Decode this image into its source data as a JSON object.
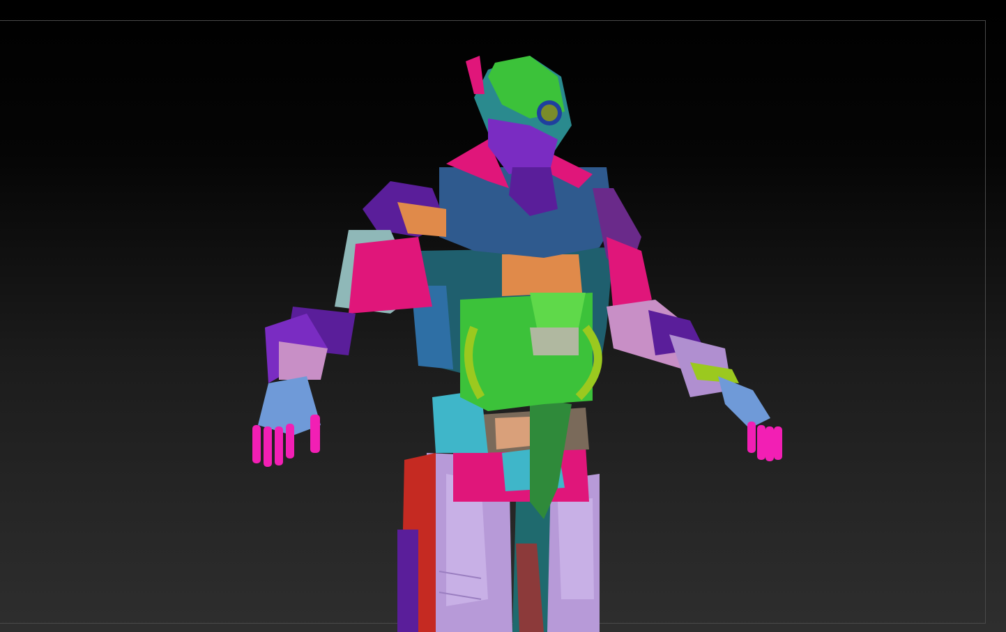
{
  "viewport": {
    "background_top": "#000000",
    "background_bottom": "#2e2e2e",
    "frame_color": "#4a4a4a"
  },
  "model": {
    "palette": {
      "blue_chest": "#2f5a8e",
      "teal_armor": "#1f5f6e",
      "green": "#3cc23a",
      "lime": "#9bc91f",
      "magenta": "#e0167a",
      "hot_pink": "#f21fb4",
      "purple": "#5a1e9a",
      "violet": "#7a2cc2",
      "lilac": "#b08fd0",
      "pink_lilac": "#c88fc6",
      "orange": "#e08a4a",
      "cyan": "#3fb6c9",
      "light_blue": "#6f9ad8",
      "red": "#c52a22",
      "olive": "#7a8c2a",
      "peach": "#d9a07a",
      "pale_teal": "#8fb8b8"
    }
  }
}
